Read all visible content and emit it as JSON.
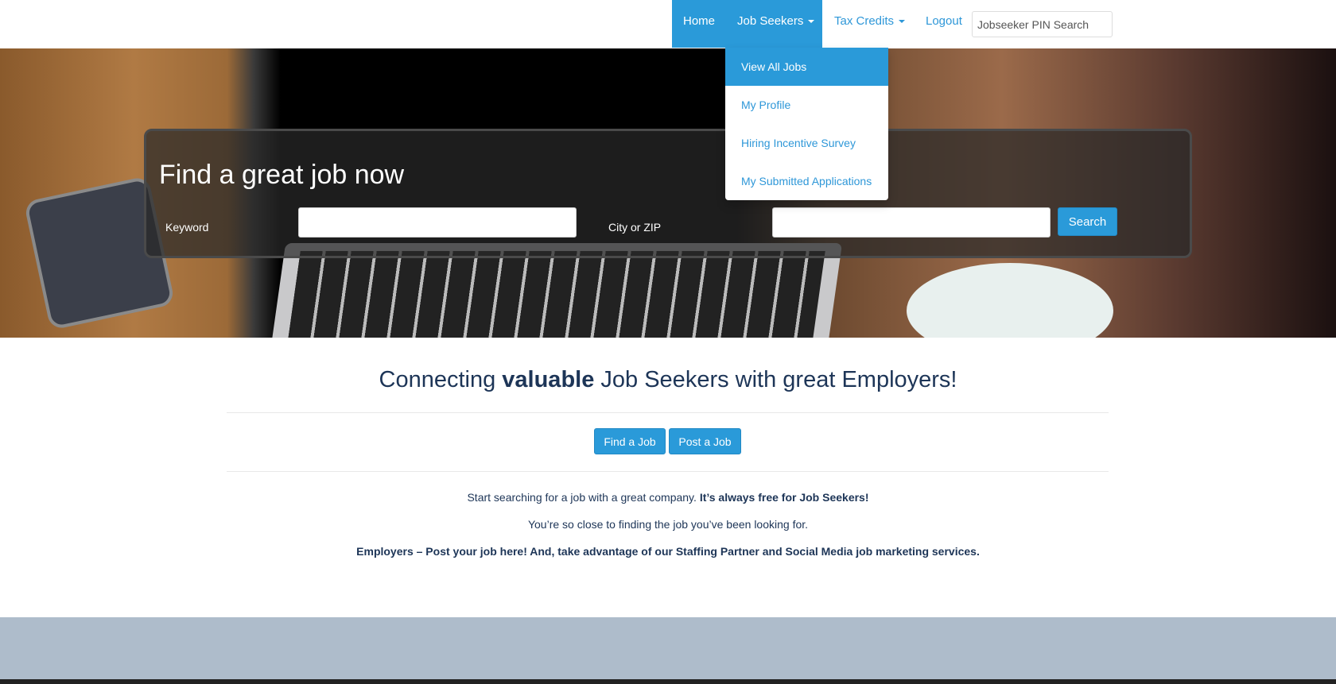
{
  "nav": {
    "home": "Home",
    "job_seekers": "Job Seekers",
    "tax_credits": "Tax Credits",
    "logout": "Logout",
    "pin_placeholder": "Jobseeker PIN Search"
  },
  "dropdown": {
    "items": [
      "View All Jobs",
      "My Profile",
      "Hiring Incentive Survey",
      "My Submitted Applications"
    ]
  },
  "hero": {
    "title": "Find a great job now",
    "keyword_label": "Keyword",
    "keyword_value": "",
    "city_label": "City or ZIP",
    "city_value": "",
    "search_label": "Search"
  },
  "main": {
    "tagline_pre": "Connecting ",
    "tagline_bold": "valuable",
    "tagline_post": " Job Seekers with great Employers!",
    "find_job": "Find a Job",
    "post_job": "Post a Job",
    "line1": "Start searching for a job with a great company. ",
    "line1_bold": "It’s always free for Job Seekers!",
    "line2": "You’re so close to finding the job you’ve been looking for.",
    "line3": "Employers – Post your job here!  And, take advantage of our Staffing Partner and Social Media job marketing services."
  },
  "colors": {
    "accent": "#2a9ad9",
    "text": "#1d3557",
    "footer": "#aebccb"
  }
}
